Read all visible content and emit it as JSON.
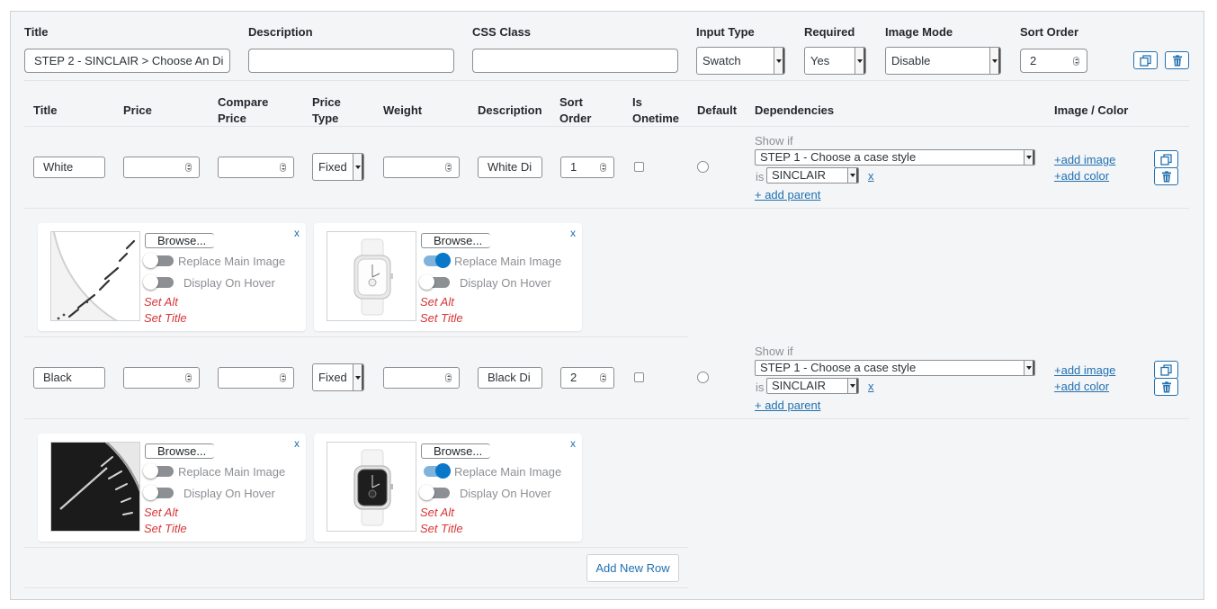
{
  "option": {
    "headers": {
      "title": "Title",
      "description": "Description",
      "css_class": "CSS Class",
      "input_type": "Input Type",
      "required": "Required",
      "image_mode": "Image Mode",
      "sort_order": "Sort Order"
    },
    "title_value": "STEP 2 - SINCLAIR > Choose An Di",
    "description_value": "",
    "css_class_value": "",
    "input_type": "Swatch",
    "required": "Yes",
    "image_mode": "Disable",
    "sort_order": "2"
  },
  "values_table": {
    "headers": {
      "title": "Title",
      "price": "Price",
      "compare_price": "Compare Price",
      "price_type": "Price Type",
      "weight": "Weight",
      "description": "Description",
      "sort_order": "Sort Order",
      "is_onetime": "Is Onetime",
      "default": "Default",
      "dependencies": "Dependencies",
      "image_color": "Image / Color"
    },
    "rows": [
      {
        "title": "White",
        "price_type": "Fixed",
        "description": "White Di",
        "sort_order": "1",
        "show_if": "Show if",
        "dependency_option": "STEP 1 - Choose a case style",
        "is_label": "is",
        "dependency_value": "SINCLAIR",
        "remove_dep": "x",
        "add_parent": "+ add parent",
        "add_image": "+add image",
        "add_color": "+add color",
        "images": [
          {
            "browse": "Browse...",
            "close": "x",
            "replace_main": "Replace Main Image",
            "replace_on": false,
            "display_hover": "Display On Hover",
            "hover_on": false,
            "set_alt": "Set Alt",
            "set_title": "Set Title"
          },
          {
            "browse": "Browse...",
            "close": "x",
            "replace_main": "Replace Main Image",
            "replace_on": true,
            "display_hover": "Display On Hover",
            "hover_on": false,
            "set_alt": "Set Alt",
            "set_title": "Set Title"
          }
        ]
      },
      {
        "title": "Black",
        "price_type": "Fixed",
        "description": "Black Di",
        "sort_order": "2",
        "show_if": "Show if",
        "dependency_option": "STEP 1 - Choose a case style",
        "is_label": "is",
        "dependency_value": "SINCLAIR",
        "remove_dep": "x",
        "add_parent": "+ add parent",
        "add_image": "+add image",
        "add_color": "+add color",
        "images": [
          {
            "browse": "Browse...",
            "close": "x",
            "replace_main": "Replace Main Image",
            "replace_on": false,
            "display_hover": "Display On Hover",
            "hover_on": false,
            "set_alt": "Set Alt",
            "set_title": "Set Title"
          },
          {
            "browse": "Browse...",
            "close": "x",
            "replace_main": "Replace Main Image",
            "replace_on": true,
            "display_hover": "Display On Hover",
            "hover_on": false,
            "set_alt": "Set Alt",
            "set_title": "Set Title"
          }
        ]
      }
    ],
    "add_new_row": "Add New Row"
  },
  "colors": {
    "accent": "#2271b1",
    "toggle_on": "#0a78c8",
    "alt_link": "#d63638"
  },
  "icons": [
    "copy-icon",
    "trash-icon",
    "chevron-down-icon",
    "spinner-icon"
  ]
}
